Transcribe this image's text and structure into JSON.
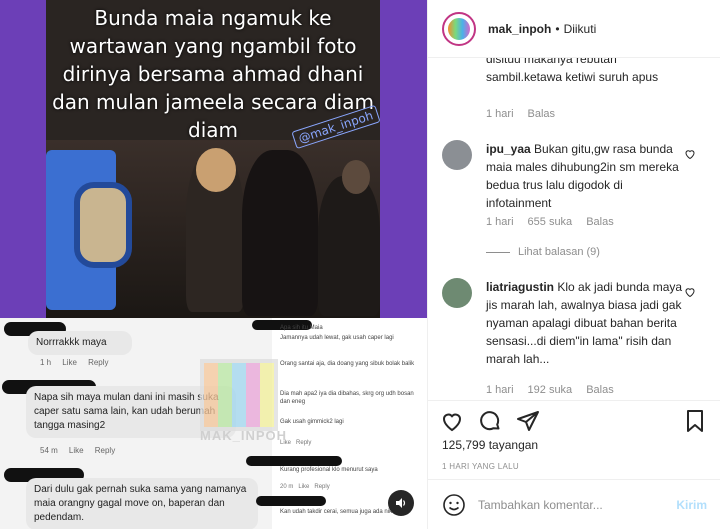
{
  "media": {
    "caption": "Bunda maia ngamuk ke wartawan yang ngambil foto dirinya bersama ahmad dhani dan mulan jameela secara diam diam",
    "watermark_top": "@mak_inpoh",
    "watermark_center": "MAK_INPOH",
    "screenshot_comments": [
      {
        "text": "Norrrakkk maya",
        "time": "1 h",
        "like": "Like",
        "reply": "Reply"
      },
      {
        "text": "Napa sih maya mulan dani ini masih suka caper satu sama lain, kan udah berumah tangga masing2",
        "time": "54 m",
        "like": "Like",
        "reply": "Reply"
      },
      {
        "text": "Dari dulu gak pernah suka sama yang namanya maia orangny gagal move on, baperan dan pedendam."
      }
    ],
    "screenshot_comments_right": [
      {
        "text": "Apa sih itu Maia"
      },
      {
        "text": "Jamannya udah lewat, gak usah caper lagi"
      },
      {
        "text": "Orang santai aja, dia doang yang sibuk bolak balik"
      },
      {
        "text": "Dia mah apa2 iya dia dibahas, skrg org udh bosan dan eneg"
      },
      {
        "text": "Gak usah gimmick2 lagi"
      },
      {
        "text": "Like",
        "reply": "Reply"
      },
      {
        "text": "Kurang profesional klo menurut saya"
      },
      {
        "time": "20 m",
        "like": "Like",
        "reply": "Reply"
      },
      {
        "text": "Kan udah takdir cerai, semua juga ada nikah"
      }
    ]
  },
  "header": {
    "username": "mak_inpoh",
    "dot": "•",
    "follow_label": "Diikuti"
  },
  "comments": [
    {
      "text": "disituu makanya rebutan sambil.ketawa ketiwi suruh apus",
      "time": "1 hari",
      "reply": "Balas"
    },
    {
      "username": "ipu_yaa",
      "text": "Bukan gitu,gw rasa bunda maia males dihubung2in sm mereka bedua trus lalu digodok di infotainment",
      "time": "1 hari",
      "likes": "655 suka",
      "reply": "Balas",
      "view_replies": "Lihat balasan (9)"
    },
    {
      "username": "liatriagustin",
      "text": "Klo ak jadi bunda maya jis marah lah, awalnya biasa jadi gak nyaman apalagi dibuat bahan berita sensasi...di diem\"in lama\" risih dan marah lah...",
      "time": "1 hari",
      "likes": "192 suka",
      "reply": "Balas"
    }
  ],
  "actions": {
    "views": "125,799 tayangan",
    "date": "1 HARI YANG LALU",
    "comment_placeholder": "Tambahkan komentar...",
    "post_label": "Kirim"
  },
  "colors": {
    "accent_purple": "#6c3fb7",
    "post_button": "#b2dffc",
    "muted_text": "#8e8e8e"
  }
}
